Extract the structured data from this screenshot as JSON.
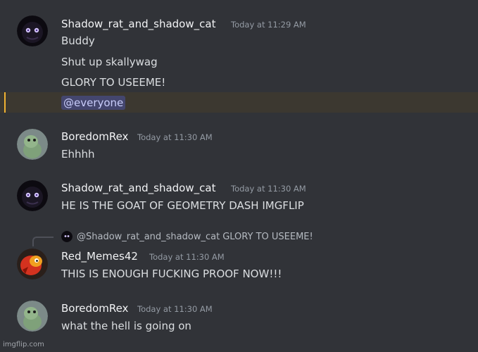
{
  "messages": [
    {
      "username": "Shadow_rat_and_shadow_cat",
      "timestamp": "Today at 11:29 AM",
      "lines": [
        "Buddy",
        "Shut up skallywag",
        "GLORY TO USEEME!"
      ],
      "mention": "@everyone"
    },
    {
      "username": "BoredomRex",
      "timestamp": "Today at 11:30 AM",
      "lines": [
        "Ehhhh"
      ]
    },
    {
      "username": "Shadow_rat_and_shadow_cat",
      "timestamp": "Today at 11:30 AM",
      "lines": [
        "HE IS THE GOAT OF GEOMETRY DASH IMGFLIP"
      ]
    },
    {
      "reply": {
        "user": "@Shadow_rat_and_shadow_cat",
        "text": "GLORY TO USEEME!"
      },
      "username": "Red_Memes42",
      "timestamp": "Today at 11:30 AM",
      "lines": [
        "THIS IS ENOUGH FUCKING PROOF NOW!!!"
      ]
    },
    {
      "username": "BoredomRex",
      "timestamp": "Today at 11:30 AM",
      "lines": [
        "what the hell is going on"
      ]
    }
  ],
  "watermark": "imgflip.com",
  "colors": {
    "background": "#313338",
    "mention_highlight": "#3c3830",
    "mention_bar": "#f0b232",
    "timestamp": "#949ba4"
  }
}
